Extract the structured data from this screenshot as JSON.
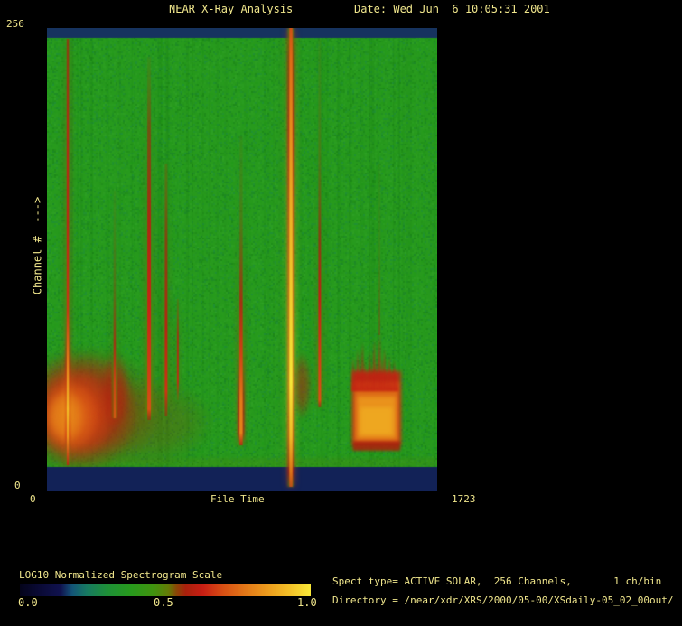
{
  "window": {
    "bg": "#000000",
    "text_color": "#f0e68c"
  },
  "header": {
    "title": "NEAR X-Ray Analysis",
    "date_label": "Date: Wed Jun  6 10:05:31 2001"
  },
  "plot": {
    "x_label": "File Time",
    "x_min_label": "0",
    "x_max_label": "1723",
    "y_label": "Channel #  --->",
    "y_min_label": "0",
    "y_max_label": "256"
  },
  "colorbar_ui": {
    "title": "LOG10 Normalized Spectrogram Scale",
    "tick_labels": [
      "0.0",
      "0.5",
      "1.0"
    ]
  },
  "info": {
    "spect_type_line": "Spect type= ACTIVE SOLAR,  256 Channels,       1 ch/bin",
    "directory_line": "Directory = /near/xdr/XRS/2000/05-00/XSdaily-05_02_00out/"
  },
  "chart_data": {
    "type": "heatmap",
    "title": "NEAR X-Ray Analysis",
    "date": "Wed Jun  6 10:05:31 2001",
    "x": {
      "label": "File Time",
      "range": [
        0,
        1723
      ]
    },
    "y": {
      "label": "Channel #",
      "range": [
        0,
        256
      ]
    },
    "colorbar": {
      "label": "LOG10 Normalized Spectrogram Scale",
      "range": [
        0.0,
        1.0
      ],
      "ticks": [
        0.0,
        0.5,
        1.0
      ],
      "stops": [
        [
          0.0,
          "#04041a"
        ],
        [
          0.07,
          "#0a0a36"
        ],
        [
          0.14,
          "#10124e"
        ],
        [
          0.18,
          "#135578"
        ],
        [
          0.23,
          "#177a62"
        ],
        [
          0.3,
          "#1e9038"
        ],
        [
          0.38,
          "#279a1d"
        ],
        [
          0.46,
          "#41930f"
        ],
        [
          0.51,
          "#637c06"
        ],
        [
          0.54,
          "#8c4406"
        ],
        [
          0.57,
          "#a8200c"
        ],
        [
          0.63,
          "#c81e14"
        ],
        [
          0.7,
          "#d85014"
        ],
        [
          0.78,
          "#e37a18"
        ],
        [
          0.86,
          "#eda01e"
        ],
        [
          0.93,
          "#f3c228"
        ],
        [
          1.0,
          "#f8e838"
        ]
      ]
    },
    "background": {
      "intensity": 0.38
    },
    "noise": {
      "cell": 2,
      "density": 0.72,
      "max_alpha": 0.38,
      "colors": [
        "#0d7012",
        "#30a526",
        "#15815a",
        "#0c6e36",
        "#38aa30",
        "#1b9a16"
      ],
      "stripe_count": 120,
      "stripe_dark": "#0a640e",
      "stripe_light": "#3aa52c"
    },
    "bands": {
      "top": {
        "ch0": 250.5,
        "ch1": 256,
        "color": "#16335f"
      },
      "bottom": {
        "ch0": 0,
        "ch1": 13,
        "color": "#122257"
      }
    },
    "haze_rects": [
      {
        "t0": 0,
        "t1": 1723,
        "ch0": 13,
        "ch1": 18,
        "i": 0.5,
        "a": 0.22,
        "blur": 2
      }
    ],
    "blobs": [
      {
        "t": 170,
        "ch": 45,
        "rt": 340,
        "rch": 36,
        "i": 0.56,
        "a": 0.5
      },
      {
        "t": 430,
        "ch": 38,
        "rt": 310,
        "rch": 25,
        "i": 0.55,
        "a": 0.3
      },
      {
        "t": 150,
        "ch": 44,
        "rt": 260,
        "rch": 33,
        "i": 0.62,
        "a": 0.8
      },
      {
        "t": 120,
        "ch": 42,
        "rt": 185,
        "rch": 26,
        "i": 0.69,
        "a": 0.85
      },
      {
        "t": 100,
        "ch": 41,
        "rt": 130,
        "rch": 20,
        "i": 0.75,
        "a": 0.9
      },
      {
        "t": 85,
        "ch": 41,
        "rt": 85,
        "rch": 15,
        "i": 0.81,
        "a": 0.9
      },
      {
        "t": 300,
        "ch": 55,
        "rt": 70,
        "rch": 22,
        "i": 0.6,
        "a": 0.55
      },
      {
        "t": 1126,
        "ch": 58,
        "rt": 45,
        "rch": 19,
        "i": 0.6,
        "a": 0.55
      }
    ],
    "solid_rects": [
      {
        "t0": 1348,
        "t1": 1563,
        "ch0": 25,
        "ch1": 66,
        "i": 0.64,
        "a": 0.88,
        "blur": 2
      },
      {
        "t0": 1356,
        "t1": 1554,
        "ch0": 27,
        "ch1": 60,
        "i": 0.76,
        "a": 0.9,
        "blur": 2
      },
      {
        "t0": 1370,
        "t1": 1540,
        "ch0": 29,
        "ch1": 52,
        "i": 0.84,
        "a": 0.9,
        "blur": 2
      },
      {
        "t0": 1384,
        "t1": 1526,
        "ch0": 31,
        "ch1": 46,
        "i": 0.88,
        "a": 0.85,
        "blur": 2
      },
      {
        "t0": 1350,
        "t1": 1560,
        "ch0": 22,
        "ch1": 27,
        "i": 0.58,
        "a": 0.85,
        "blur": 1.5
      }
    ],
    "spikes": {
      "i": 0.62,
      "a": 0.8,
      "w": 4,
      "base_ch": 55,
      "points": [
        [
          1352,
          74
        ],
        [
          1362,
          68
        ],
        [
          1372,
          78
        ],
        [
          1383,
          70
        ],
        [
          1393,
          82
        ],
        [
          1404,
          72
        ],
        [
          1414,
          67
        ],
        [
          1424,
          77
        ],
        [
          1435,
          70
        ],
        [
          1445,
          84
        ],
        [
          1456,
          72
        ],
        [
          1468,
          88
        ],
        [
          1479,
          73
        ],
        [
          1490,
          79
        ],
        [
          1501,
          68
        ],
        [
          1512,
          75
        ],
        [
          1523,
          66
        ],
        [
          1534,
          72
        ],
        [
          1545,
          64
        ]
      ]
    },
    "streaks": [
      {
        "t": 92,
        "w": 2.5,
        "glow": 7,
        "ga": 0.3,
        "p": [
          [
            250,
            0.58,
            0.7
          ],
          [
            201,
            0.62,
            0.85
          ],
          [
            150,
            0.63,
            0.9
          ],
          [
            100,
            0.66,
            0.95
          ],
          [
            70,
            0.8,
            1
          ],
          [
            45,
            0.92,
            1
          ],
          [
            30,
            0.85,
            1
          ],
          [
            14,
            0.62,
            0.85
          ]
        ]
      },
      {
        "t": 451,
        "w": 4,
        "glow": 9,
        "ga": 0.28,
        "p": [
          [
            240,
            0.5,
            0.25
          ],
          [
            201,
            0.56,
            0.6
          ],
          [
            150,
            0.6,
            0.9
          ],
          [
            100,
            0.64,
            1
          ],
          [
            60,
            0.68,
            1
          ],
          [
            45,
            0.7,
            1
          ],
          [
            39,
            0.58,
            0.6
          ]
        ]
      },
      {
        "t": 526,
        "w": 3,
        "glow": 7,
        "ga": 0.25,
        "p": [
          [
            181,
            0.52,
            0.45
          ],
          [
            140,
            0.56,
            0.75
          ],
          [
            90,
            0.61,
            0.95
          ],
          [
            55,
            0.66,
            1
          ],
          [
            41,
            0.56,
            0.6
          ]
        ]
      },
      {
        "t": 578,
        "w": 2,
        "glow": 5,
        "ga": 0.2,
        "p": [
          [
            106,
            0.52,
            0.4
          ],
          [
            85,
            0.6,
            0.8
          ],
          [
            60,
            0.64,
            0.9
          ],
          [
            50,
            0.52,
            0.5
          ]
        ]
      },
      {
        "t": 299,
        "w": 2.5,
        "glow": 6,
        "ga": 0.25,
        "p": [
          [
            166,
            0.5,
            0.2
          ],
          [
            110,
            0.54,
            0.45
          ],
          [
            81,
            0.6,
            0.8
          ],
          [
            60,
            0.68,
            0.95
          ],
          [
            40,
            0.72,
            0.9
          ]
        ]
      },
      {
        "t": 857,
        "w": 3.5,
        "glow": 8,
        "ga": 0.3,
        "p": [
          [
            196,
            0.5,
            0.2
          ],
          [
            150,
            0.53,
            0.4
          ],
          [
            104,
            0.6,
            0.85
          ],
          [
            75,
            0.68,
            1
          ],
          [
            50,
            0.78,
            1
          ],
          [
            32,
            0.8,
            1
          ],
          [
            25,
            0.62,
            0.8
          ]
        ]
      },
      {
        "t": 1077,
        "w": 3.5,
        "glow": 10,
        "ga": 0.4,
        "cross": true,
        "p": [
          [
            256,
            0.7,
            0.95
          ],
          [
            240,
            0.75,
            1
          ],
          [
            200,
            0.82,
            1
          ],
          [
            150,
            0.9,
            1
          ],
          [
            100,
            0.96,
            1
          ],
          [
            60,
            1.0,
            1
          ],
          [
            30,
            0.92,
            1
          ],
          [
            10,
            0.78,
            0.9
          ],
          [
            2,
            0.7,
            0.8
          ]
        ]
      },
      {
        "t": 1204,
        "w": 3,
        "glow": 7,
        "ga": 0.25,
        "p": [
          [
            250,
            0.5,
            0.2
          ],
          [
            180,
            0.53,
            0.4
          ],
          [
            140,
            0.57,
            0.7
          ],
          [
            106,
            0.62,
            0.95
          ],
          [
            70,
            0.68,
            1
          ],
          [
            50,
            0.7,
            1
          ],
          [
            46,
            0.58,
            0.6
          ]
        ]
      },
      {
        "t": 1468,
        "w": 1.5,
        "glow": 4,
        "ga": 0.15,
        "p": [
          [
            181,
            0.5,
            0.18
          ],
          [
            130,
            0.52,
            0.3
          ],
          [
            100,
            0.55,
            0.45
          ],
          [
            86,
            0.56,
            0.5
          ]
        ]
      }
    ]
  }
}
